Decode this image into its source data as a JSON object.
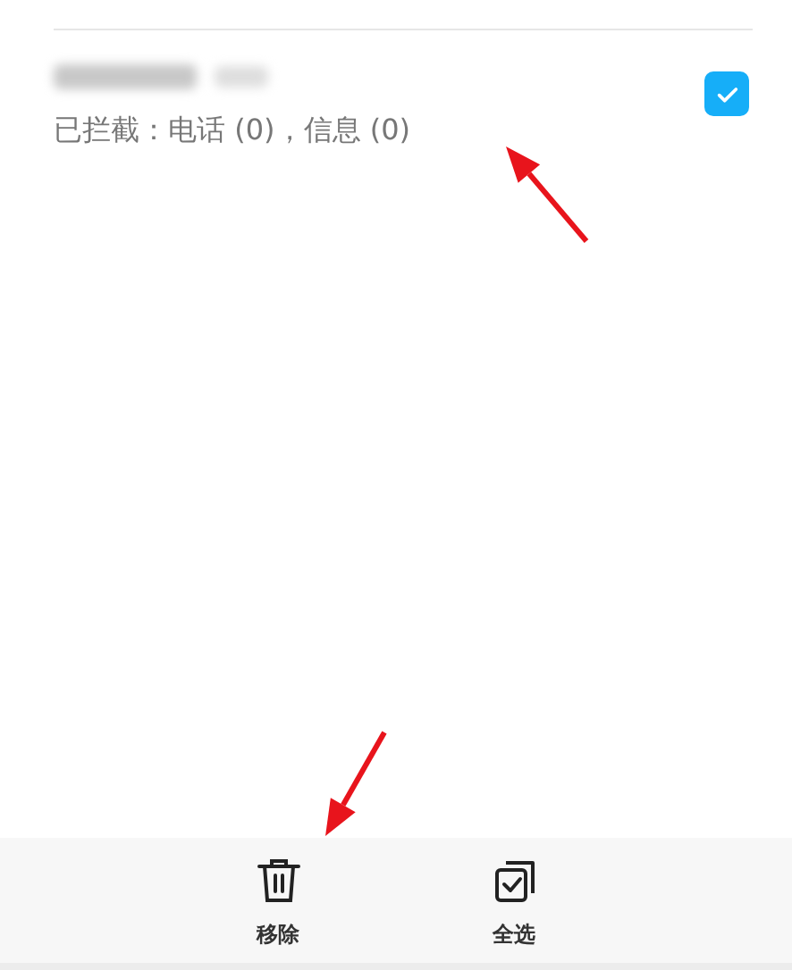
{
  "list": [
    {
      "name_redacted": true,
      "subtitle": "已拦截：电话 (0)，信息 (0)",
      "checked": true
    }
  ],
  "annotations": [
    {
      "kind": "arrow"
    },
    {
      "kind": "arrow"
    }
  ],
  "bottom_bar": [
    {
      "kind": "trash",
      "label": "移除"
    },
    {
      "kind": "select_all",
      "label": "全选"
    }
  ]
}
